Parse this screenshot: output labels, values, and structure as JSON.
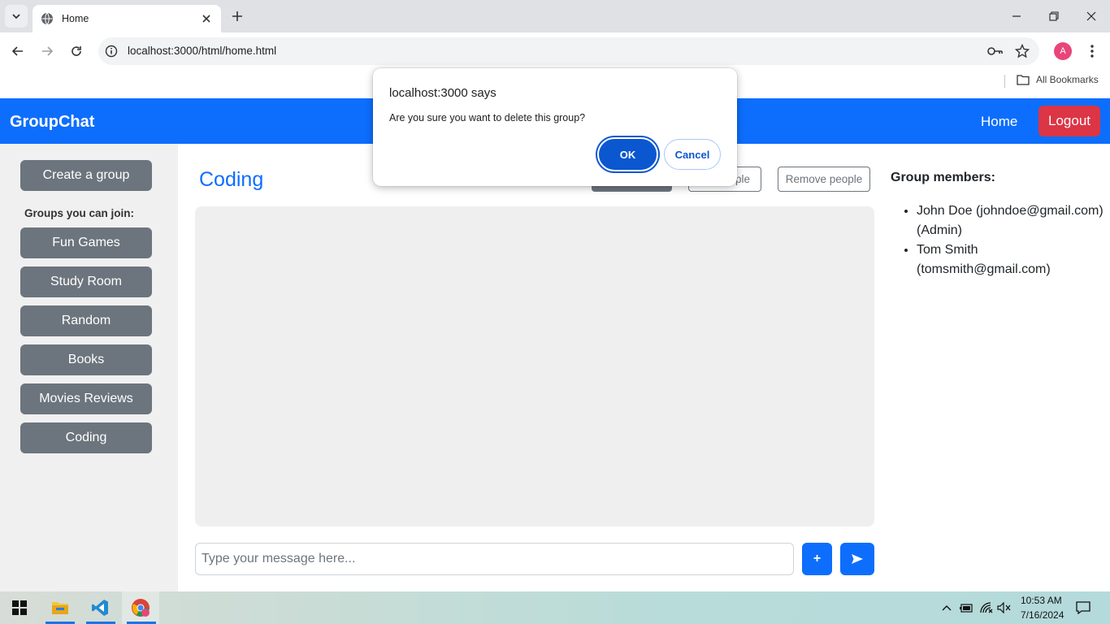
{
  "browser": {
    "tab_title": "Home",
    "url": "localhost:3000/html/home.html",
    "bookmarks_label": "All Bookmarks",
    "profile_initial": "A"
  },
  "navbar": {
    "brand": "GroupChat",
    "home": "Home",
    "logout": "Logout"
  },
  "sidebar": {
    "create_group": "Create a group",
    "heading": "Groups you can join:",
    "groups": [
      "Fun Games",
      "Study Room",
      "Random",
      "Books",
      "Movies Reviews",
      "Coding"
    ]
  },
  "main": {
    "group_title": "Coding",
    "add_people_partial": "ple",
    "remove_people": "Remove people",
    "message_placeholder": "Type your message here...",
    "attach_label": "+"
  },
  "members": {
    "heading": "Group members:",
    "list": [
      "John Doe (johndoe@gmail.com) (Admin)",
      "Tom Smith (tomsmith@gmail.com)"
    ]
  },
  "dialog": {
    "title": "localhost:3000 says",
    "message": "Are you sure you want to delete this group?",
    "ok": "OK",
    "cancel": "Cancel"
  },
  "taskbar": {
    "time": "10:53 AM",
    "date": "7/16/2024"
  },
  "colors": {
    "primary": "#0d6efd",
    "danger": "#dc3545",
    "secondary": "#6c757d",
    "dialog_button": "#0b57d0"
  }
}
